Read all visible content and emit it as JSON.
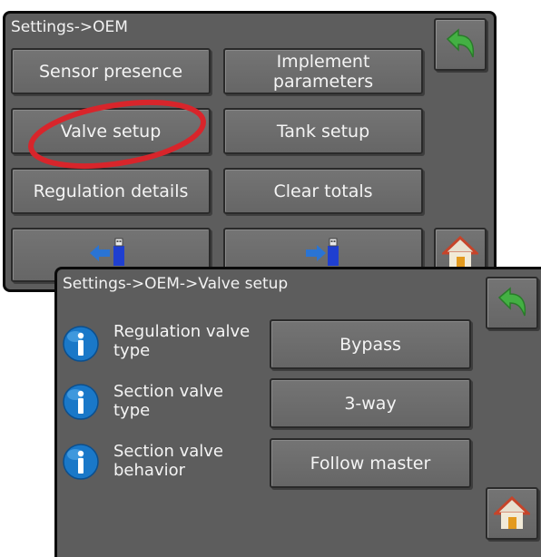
{
  "oem_screen": {
    "breadcrumb": "Settings->OEM",
    "buttons": {
      "sensor_presence": "Sensor presence",
      "implement_parameters": "Implement parameters",
      "valve_setup": "Valve setup",
      "tank_setup": "Tank setup",
      "regulation_details": "Regulation details",
      "clear_totals": "Clear totals"
    },
    "usb_export_icon": "usb-export-icon",
    "usb_import_icon": "usb-import-icon",
    "back_icon": "back-arrow-icon",
    "home_icon": "home-icon",
    "highlight_color": "#d8252b"
  },
  "valve_screen": {
    "breadcrumb": "Settings->OEM->Valve setup",
    "rows": [
      {
        "label": "Regulation valve type",
        "value": "Bypass"
      },
      {
        "label": "Section valve type",
        "value": "3-way"
      },
      {
        "label": "Section valve behavior",
        "value": "Follow master"
      }
    ],
    "info_icon": "info-icon",
    "back_icon": "back-arrow-icon",
    "home_icon": "home-icon"
  },
  "colors": {
    "panel": "#5d5d5d",
    "button": "#6e6e6e",
    "back_arrow": "#43b043",
    "info_blue": "#1a78c8"
  }
}
